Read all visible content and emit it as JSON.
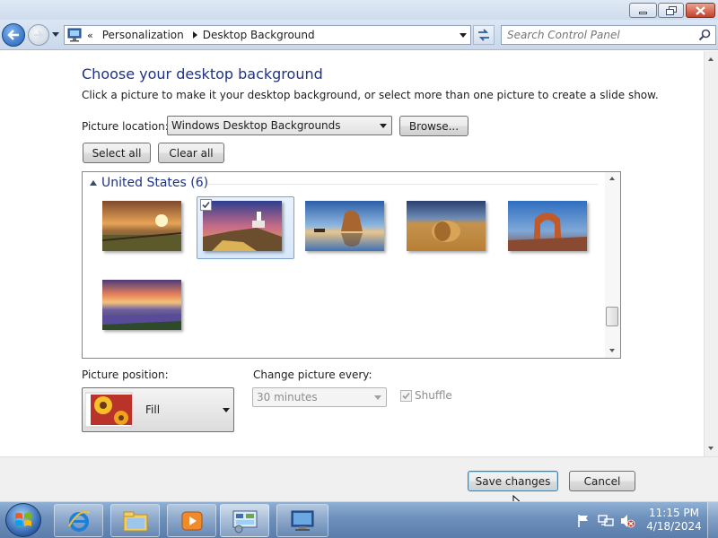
{
  "window": {
    "breadcrumb": [
      "Personalization",
      "Desktop Background"
    ],
    "search_placeholder": "Search Control Panel"
  },
  "page": {
    "title": "Choose your desktop background",
    "subtitle": "Click a picture to make it your desktop background, or select more than one picture to create a slide show.",
    "picture_location_label": "Picture location:",
    "picture_location_value": "Windows Desktop Backgrounds",
    "browse_label": "Browse...",
    "select_all_label": "Select all",
    "clear_all_label": "Clear all",
    "group_title": "United States (6)",
    "pictures": [
      {
        "scene": "sunset-fence",
        "selected": false
      },
      {
        "scene": "lighthouse",
        "selected": true
      },
      {
        "scene": "haystack-rock",
        "selected": false
      },
      {
        "scene": "hay-bale",
        "selected": false
      },
      {
        "scene": "delicate-arch",
        "selected": false
      },
      {
        "scene": "lupine-lake",
        "selected": false
      }
    ],
    "picture_position_label": "Picture position:",
    "picture_position_value": "Fill",
    "change_picture_label": "Change picture every:",
    "change_picture_value": "30 minutes",
    "shuffle_label": "Shuffle",
    "shuffle_checked": true
  },
  "footer": {
    "save_label": "Save changes",
    "cancel_label": "Cancel"
  },
  "taskbar": {
    "time": "11:15 PM",
    "date": "4/18/2024"
  },
  "colors": {
    "heading": "#1e3287",
    "taskbar": "#6c8fbb",
    "close_button": "#c4412a"
  }
}
